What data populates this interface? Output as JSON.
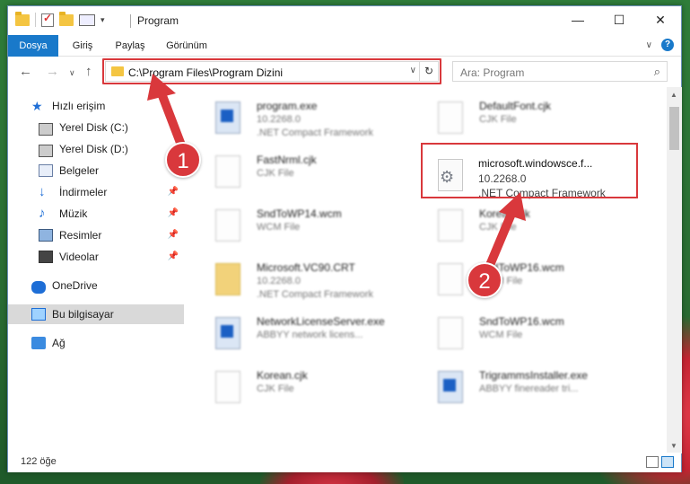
{
  "window": {
    "title": "Program",
    "controls": {
      "minimize": "—",
      "maximize": "☐",
      "close": "✕"
    }
  },
  "ribbon": {
    "tabs": [
      "Dosya",
      "Giriş",
      "Paylaş",
      "Görünüm"
    ],
    "active_tab": "Dosya",
    "help": "?"
  },
  "address": {
    "path": "C:\\Program Files\\Program Dizini",
    "search_placeholder": "Ara: Program"
  },
  "nav": {
    "items": [
      {
        "label": "Hızlı erişim",
        "icon": "star-icon",
        "pinned": false
      },
      {
        "label": "Yerel Disk (C:)",
        "icon": "drive-icon",
        "pinned": false
      },
      {
        "label": "Yerel Disk (D:)",
        "icon": "drive-icon",
        "pinned": false
      },
      {
        "label": "Belgeler",
        "icon": "document-icon",
        "pinned": false
      },
      {
        "label": "İndirmeler",
        "icon": "download-icon",
        "pinned": true
      },
      {
        "label": "Müzik",
        "icon": "music-icon",
        "pinned": true
      },
      {
        "label": "Resimler",
        "icon": "picture-icon",
        "pinned": true
      },
      {
        "label": "Videolar",
        "icon": "video-icon",
        "pinned": true
      },
      {
        "label": "OneDrive",
        "icon": "cloud-icon",
        "pinned": false
      },
      {
        "label": "Bu bilgisayar",
        "icon": "computer-icon",
        "pinned": false
      },
      {
        "label": "Ağ",
        "icon": "network-icon",
        "pinned": false
      }
    ],
    "selected": "Bu bilgisayar"
  },
  "files": [
    {
      "name": "program.exe",
      "type": "10.2268.0",
      "sub": ".NET Compact Framework",
      "kind": "exe"
    },
    {
      "name": "DefaultFont.cjk",
      "type": "CJK File",
      "sub": "",
      "kind": "doc"
    },
    {
      "name": "FastNrml.cjk",
      "type": "CJK File",
      "sub": "",
      "kind": "doc"
    },
    {
      "name": "SndToWP14.wcm",
      "type": "WCM File",
      "sub": "",
      "kind": "doc"
    },
    {
      "name": "Korean.cjk",
      "type": "CJK File",
      "sub": "",
      "kind": "doc"
    },
    {
      "name": "Microsoft.VC90.CRT",
      "type": "10.2268.0",
      "sub": ".NET Compact Framework",
      "kind": "folder"
    },
    {
      "name": "SndToWP16.wcm",
      "type": "WCM File",
      "sub": "",
      "kind": "doc"
    },
    {
      "name": "NetworkLicenseServer.exe",
      "type": "ABBYY network licens...",
      "sub": "",
      "kind": "exe"
    },
    {
      "name": "SndToWP16.wcm",
      "type": "WCM File",
      "sub": "",
      "kind": "doc"
    },
    {
      "name": "Korean.cjk",
      "type": "CJK File",
      "sub": "",
      "kind": "doc"
    },
    {
      "name": "TrigrammsInstaller.exe",
      "type": "ABBYY finereader tri...",
      "sub": "",
      "kind": "exe"
    }
  ],
  "highlighted_file": {
    "name": "microsoft.windowsce.f...",
    "version": "10.2268.0",
    "type": ".NET Compact Framework"
  },
  "status": {
    "count": "122 öğe"
  },
  "annotations": {
    "badge1": "1",
    "badge2": "2"
  },
  "colors": {
    "accent": "#1979ca",
    "highlight": "#d9383c"
  }
}
